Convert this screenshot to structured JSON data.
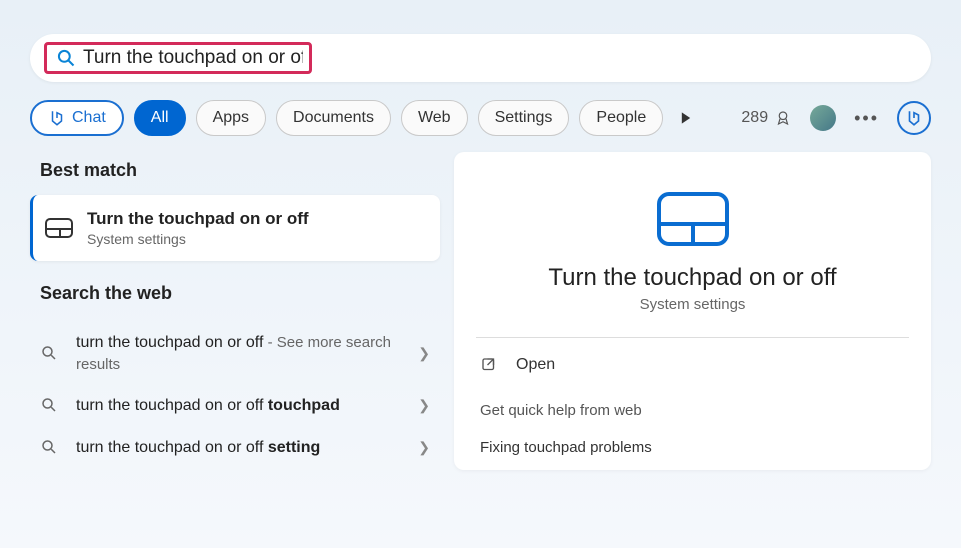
{
  "search": {
    "query": "Turn the touchpad on or off"
  },
  "filters": {
    "chat": "Chat",
    "all": "All",
    "apps": "Apps",
    "documents": "Documents",
    "web": "Web",
    "settings": "Settings",
    "people": "People"
  },
  "points": "289",
  "left": {
    "best_match_label": "Best match",
    "best_match": {
      "title": "Turn the touchpad on or off",
      "subtitle": "System settings"
    },
    "search_web_label": "Search the web",
    "web_items": [
      {
        "prefix": "turn the touchpad on or off",
        "suffix": " - See more search results",
        "bold": ""
      },
      {
        "prefix": "turn the touchpad on or off ",
        "suffix": "",
        "bold": "touchpad"
      },
      {
        "prefix": "turn the touchpad on or off ",
        "suffix": "",
        "bold": "setting"
      }
    ]
  },
  "right": {
    "title": "Turn the touchpad on or off",
    "subtitle": "System settings",
    "open_label": "Open",
    "help_label": "Get quick help from web",
    "help_link1": "Fixing touchpad problems"
  }
}
